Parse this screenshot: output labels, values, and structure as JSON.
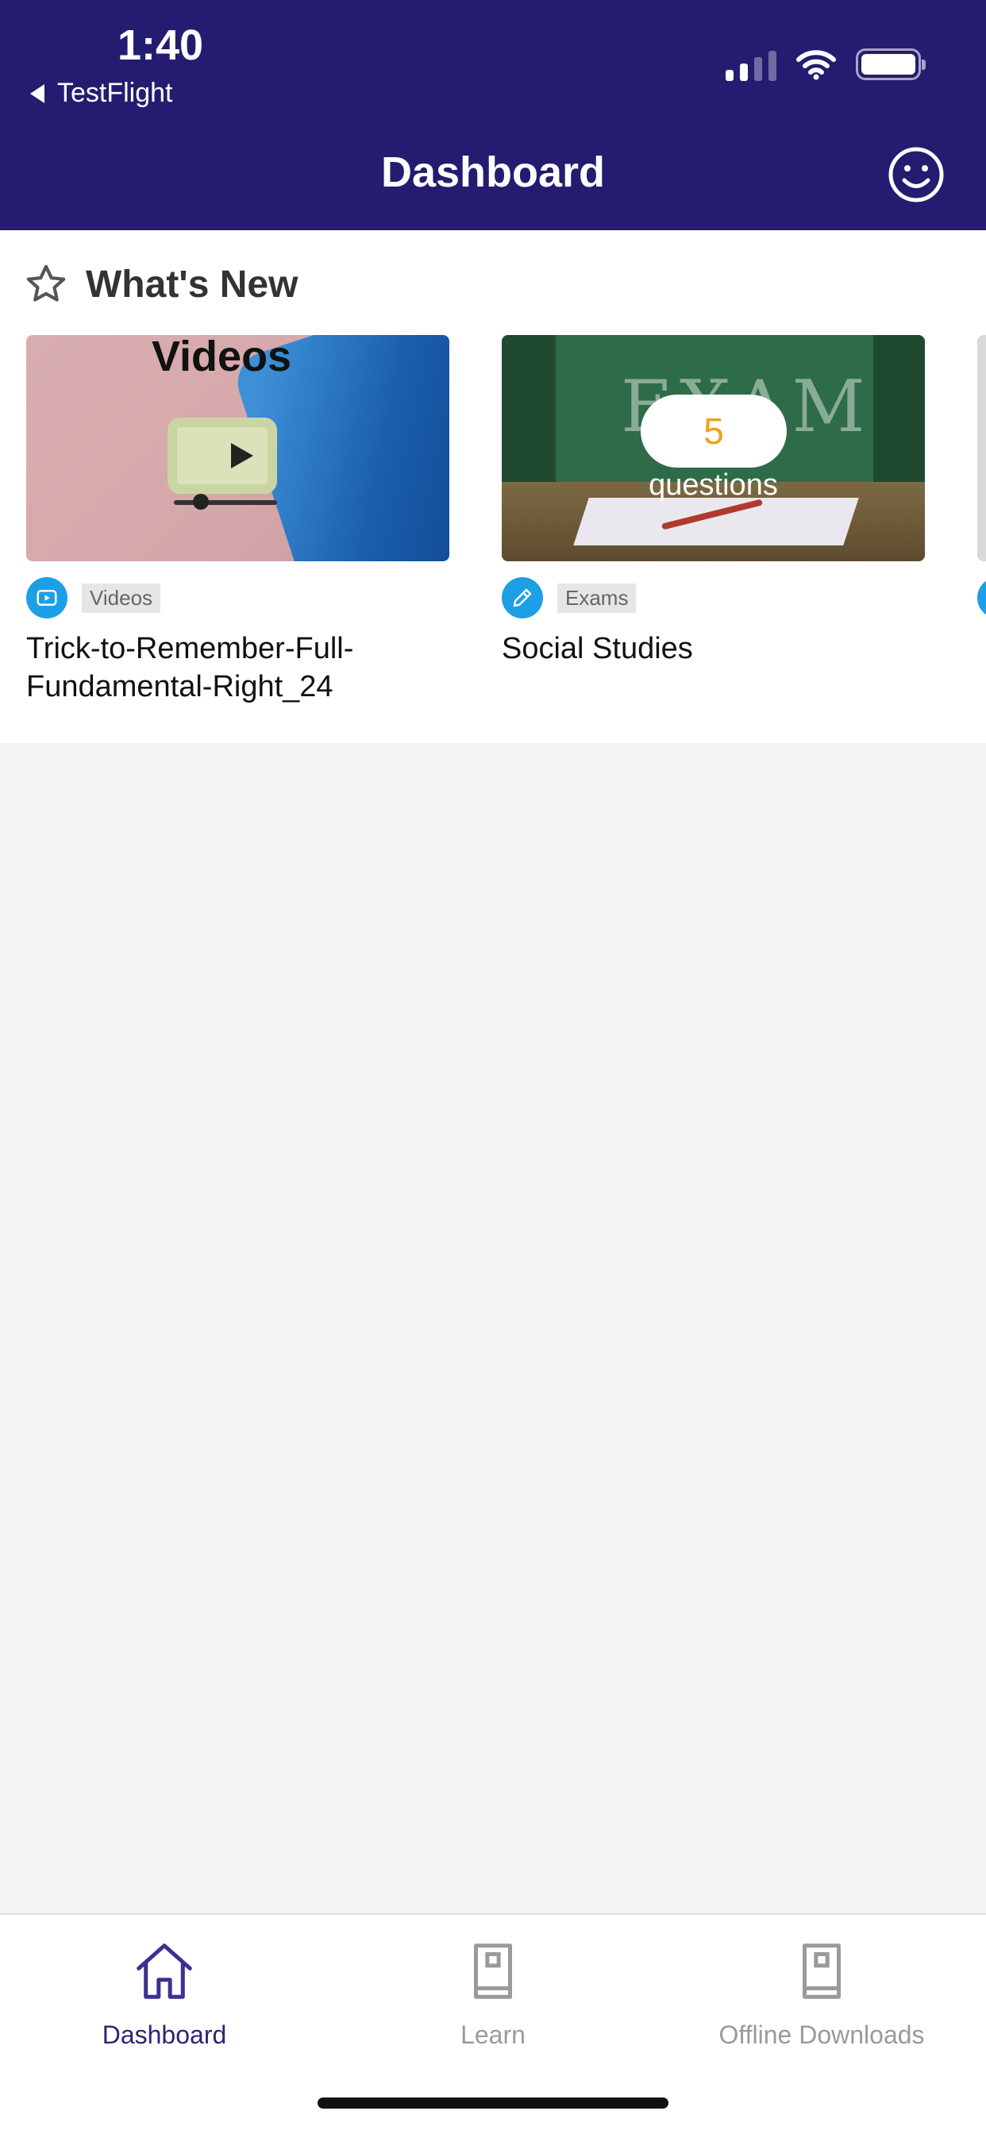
{
  "status_bar": {
    "time": "1:40",
    "back_label": "TestFlight"
  },
  "header": {
    "title": "Dashboard"
  },
  "whats_new": {
    "title": "What's New",
    "cards": [
      {
        "thumb_text": "Videos",
        "tag": "Videos",
        "title": "Trick-to-Remember-Full-Fundamental-Right_24",
        "type_icon": "video-icon"
      },
      {
        "thumb_text": "EXAM",
        "question_count": "5",
        "question_label": "questions",
        "tag": "Exams",
        "title": "Social Studies",
        "type_icon": "pencil-icon"
      }
    ]
  },
  "tabs": [
    {
      "label": "Dashboard",
      "icon": "home-icon",
      "active": true
    },
    {
      "label": "Learn",
      "icon": "book-icon",
      "active": false
    },
    {
      "label": "Offline Downloads",
      "icon": "book-icon",
      "active": false
    }
  ],
  "colors": {
    "header_bg": "#241c70",
    "accent": "#1d9fe6",
    "active_tab": "#2b2478",
    "question_count": "#f0a019"
  }
}
